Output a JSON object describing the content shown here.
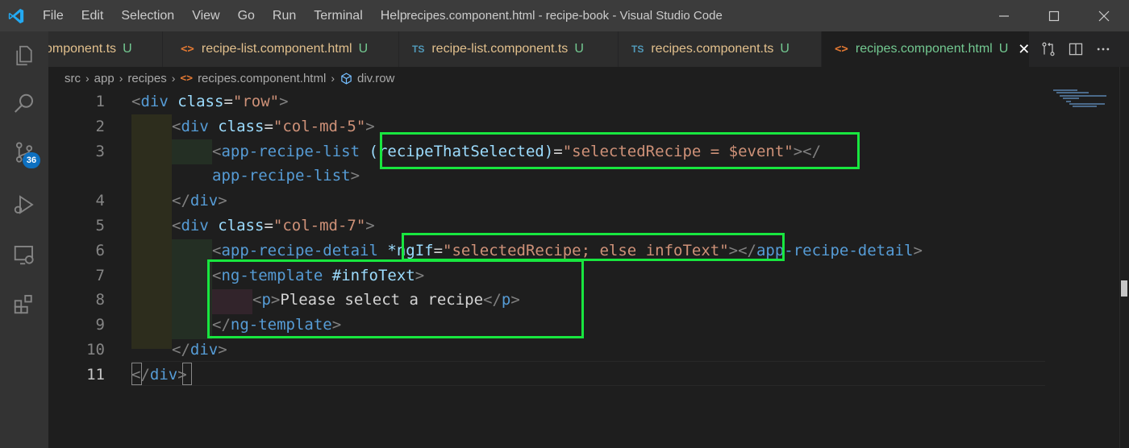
{
  "window": {
    "title": "recipes.component.html - recipe-book - Visual Studio Code",
    "colors": {
      "accent": "#0e70c0",
      "highlight": "#18e63f",
      "modified": "#73c991"
    }
  },
  "menu": [
    "File",
    "Edit",
    "Selection",
    "View",
    "Go",
    "Run",
    "Terminal",
    "Help"
  ],
  "activity": {
    "icons": [
      "explorer-icon",
      "search-icon",
      "source-control-icon",
      "run-debug-icon",
      "remote-explorer-icon",
      "extensions-icon"
    ],
    "source_control_badge": "36"
  },
  "tabs": [
    {
      "icon": "<>",
      "icon_type": "html",
      "name": "omponent.ts",
      "status": "U"
    },
    {
      "icon": "<>",
      "icon_type": "html",
      "name": "recipe-list.component.html",
      "status": "U"
    },
    {
      "icon": "TS",
      "icon_type": "ts",
      "name": "recipe-list.component.ts",
      "status": "U"
    },
    {
      "icon": "TS",
      "icon_type": "ts",
      "name": "recipes.component.ts",
      "status": "U"
    },
    {
      "icon": "<>",
      "icon_type": "html",
      "name": "recipes.component.html",
      "status": "U",
      "active": true
    }
  ],
  "breadcrumb": [
    "src",
    "app",
    "recipes",
    "recipes.component.html",
    "div.row"
  ],
  "editor": {
    "line_numbers": [
      "1",
      "2",
      "3",
      "",
      "4",
      "5",
      "6",
      "7",
      "8",
      "9",
      "10",
      "11"
    ],
    "current_line": "11",
    "lines": [
      [
        [
          "bracket",
          "<"
        ],
        [
          "tag",
          "div"
        ],
        [
          "txt",
          " "
        ],
        [
          "attr",
          "class"
        ],
        [
          "txt",
          "="
        ],
        [
          "str",
          "\"row\""
        ],
        [
          "bracket",
          ">"
        ]
      ],
      [
        [
          "bracket",
          "<"
        ],
        [
          "tag",
          "div"
        ],
        [
          "txt",
          " "
        ],
        [
          "attr",
          "class"
        ],
        [
          "txt",
          "="
        ],
        [
          "str",
          "\"col-md-5\""
        ],
        [
          "bracket",
          ">"
        ]
      ],
      [
        [
          "bracket",
          "<"
        ],
        [
          "tag",
          "app-recipe-list"
        ],
        [
          "txt",
          " "
        ],
        [
          "attr",
          "(recipeThatSelected)"
        ],
        [
          "txt",
          "="
        ],
        [
          "str",
          "\"selectedRecipe = $event\""
        ],
        [
          "bracket",
          "></"
        ]
      ],
      [
        [
          "tag",
          "app-recipe-list"
        ],
        [
          "bracket",
          ">"
        ]
      ],
      [
        [
          "bracket",
          "</"
        ],
        [
          "tag",
          "div"
        ],
        [
          "bracket",
          ">"
        ]
      ],
      [
        [
          "bracket",
          "<"
        ],
        [
          "tag",
          "div"
        ],
        [
          "txt",
          " "
        ],
        [
          "attr",
          "class"
        ],
        [
          "txt",
          "="
        ],
        [
          "str",
          "\"col-md-7\""
        ],
        [
          "bracket",
          ">"
        ]
      ],
      [
        [
          "bracket",
          "<"
        ],
        [
          "tag",
          "app-recipe-detail"
        ],
        [
          "txt",
          " "
        ],
        [
          "attr",
          "*ngIf"
        ],
        [
          "txt",
          "="
        ],
        [
          "str",
          "\"selectedRecipe; else infoText\""
        ],
        [
          "bracket",
          "></"
        ],
        [
          "tag",
          "app-recipe-detail"
        ],
        [
          "bracket",
          ">"
        ]
      ],
      [
        [
          "bracket",
          "<"
        ],
        [
          "tag",
          "ng-template"
        ],
        [
          "txt",
          " "
        ],
        [
          "attr",
          "#infoText"
        ],
        [
          "bracket",
          ">"
        ]
      ],
      [
        [
          "bracket",
          "<"
        ],
        [
          "tag",
          "p"
        ],
        [
          "bracket",
          ">"
        ],
        [
          "txt",
          "Please select a recipe"
        ],
        [
          "bracket",
          "</"
        ],
        [
          "tag",
          "p"
        ],
        [
          "bracket",
          ">"
        ]
      ],
      [
        [
          "bracket",
          "</"
        ],
        [
          "tag",
          "ng-template"
        ],
        [
          "bracket",
          ">"
        ]
      ],
      [
        [
          "bracket",
          "</"
        ],
        [
          "tag",
          "div"
        ],
        [
          "bracket",
          ">"
        ]
      ],
      [
        [
          "bracket",
          "</"
        ],
        [
          "tag",
          "div"
        ],
        [
          "bracket",
          ">"
        ]
      ]
    ]
  }
}
